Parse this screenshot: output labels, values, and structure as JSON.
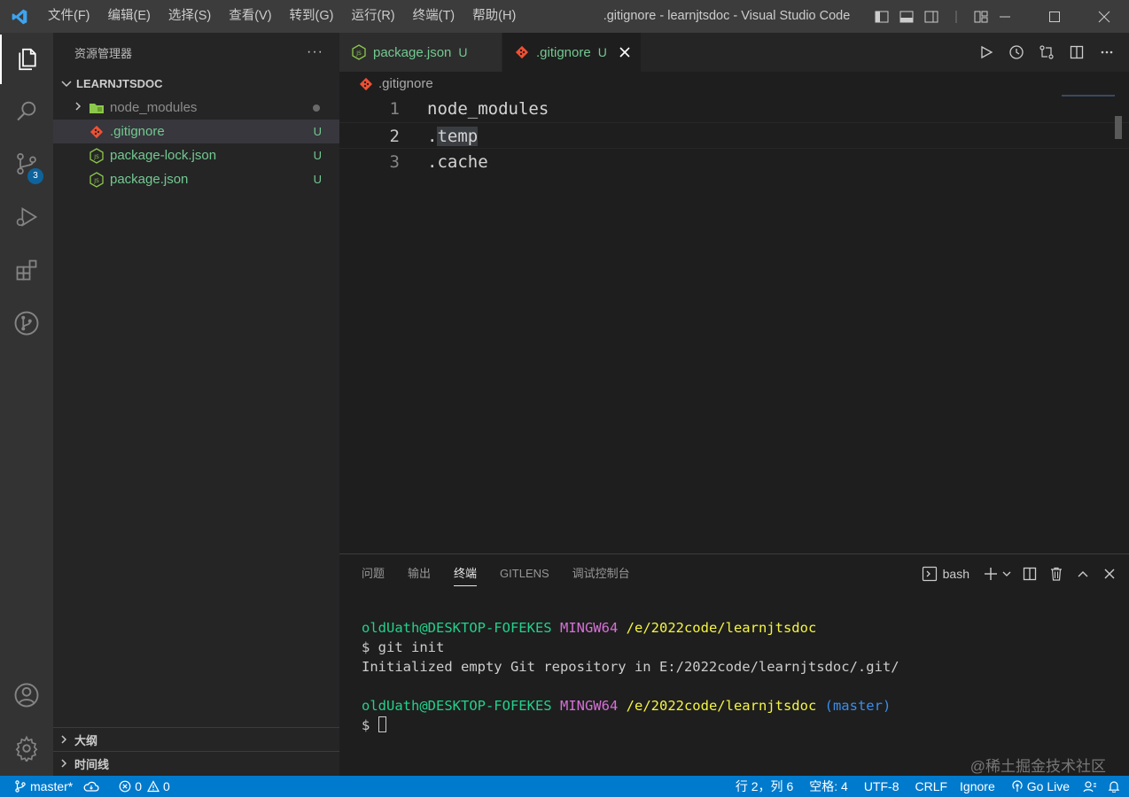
{
  "titlebar": {
    "menus": [
      "文件(F)",
      "编辑(E)",
      "选择(S)",
      "查看(V)",
      "转到(G)",
      "运行(R)",
      "终端(T)",
      "帮助(H)"
    ],
    "window_title": ".gitignore - learnjtsdoc - Visual Studio Code"
  },
  "activity": {
    "items": [
      "explorer-icon",
      "search-icon",
      "source-control-icon",
      "run-debug-icon",
      "extensions-icon",
      "gitlens-icon",
      "account-icon",
      "settings-gear-icon"
    ],
    "scm_badge": "3"
  },
  "sidebar": {
    "title": "资源管理器",
    "more": "···",
    "folder": "LEARNJTSDOC",
    "tree": [
      {
        "name": "node_modules",
        "status": "",
        "type": "folder"
      },
      {
        "name": ".gitignore",
        "status": "U",
        "type": "git"
      },
      {
        "name": "package-lock.json",
        "status": "U",
        "type": "node"
      },
      {
        "name": "package.json",
        "status": "U",
        "type": "node"
      }
    ],
    "outline": "大纲",
    "timeline": "时间线"
  },
  "editor": {
    "tabs": [
      {
        "label": "package.json",
        "status": "U"
      },
      {
        "label": ".gitignore",
        "status": "U"
      }
    ],
    "breadcrumb": ".gitignore",
    "lines": [
      {
        "num": "1",
        "text": "node_modules"
      },
      {
        "num": "2",
        "text_pre": ".",
        "text_hl": "temp"
      },
      {
        "num": "3",
        "text": ".cache"
      }
    ]
  },
  "panel": {
    "tabs": [
      "问题",
      "输出",
      "终端",
      "GITLENS",
      "调试控制台"
    ],
    "shell": "bash",
    "terminal": {
      "user": "oldUath@DESKTOP-FOFEKES",
      "env": "MINGW64",
      "path": "/e/2022code/learnjtsdoc",
      "cmd": "$ git init",
      "output": "Initialized empty Git repository in E:/2022code/learnjtsdoc/.git/",
      "branch": "(master)",
      "prompt": "$ "
    }
  },
  "statusbar": {
    "branch": "master*",
    "errors": "0",
    "warnings": "0",
    "position": "行 2，列 6",
    "spaces": "空格: 4",
    "encoding": "UTF-8",
    "eol": "CRLF",
    "language": "Ignore",
    "golive": "Go Live"
  },
  "watermark": "@稀土掘金技术社区",
  "colors": {
    "accent": "#007acc",
    "untracked": "#73c991",
    "git_orange": "#f05033",
    "node_green": "#8cc84b"
  }
}
